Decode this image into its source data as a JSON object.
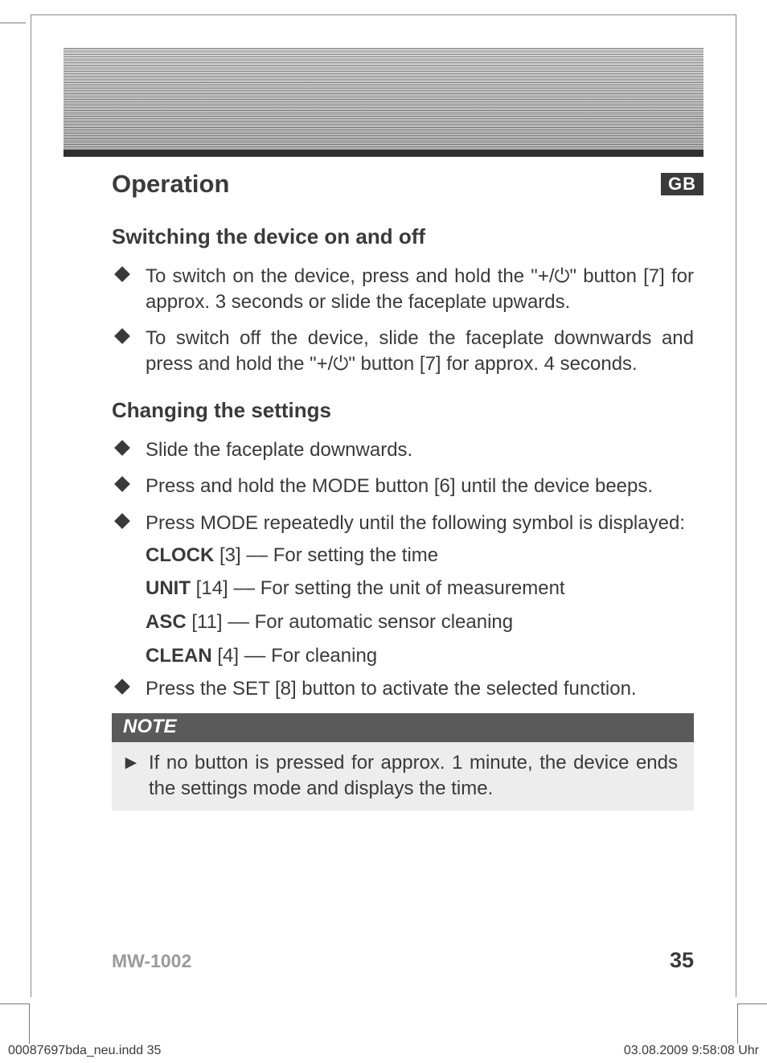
{
  "header": {
    "section": "Operation",
    "language_badge": "GB"
  },
  "sections": {
    "switching": {
      "heading": "Switching the device on and off",
      "items": [
        "To switch on the device, press and hold the \"+/⏻\" button [7] for approx. 3 seconds or slide the faceplate upwards.",
        "To switch off the device, slide the faceplate downwards and press and hold the \"+/⏻\" button [7] for approx. 4 seconds."
      ]
    },
    "changing": {
      "heading": "Changing the settings",
      "items": [
        "Slide the faceplate downwards.",
        "Press and hold the MODE button [6] until the device beeps.",
        "Press MODE repeatedly until the following symbol is displayed:"
      ],
      "modes": [
        {
          "label": "CLOCK",
          "ref": "[3]",
          "desc": "–– For setting the time"
        },
        {
          "label": "UNIT",
          "ref": "[14]",
          "desc": "–– For setting the unit of measurement"
        },
        {
          "label": "ASC",
          "ref": "[11]",
          "desc": "–– For automatic sensor cleaning"
        },
        {
          "label": "CLEAN",
          "ref": "[4]",
          "desc": "–– For cleaning"
        }
      ],
      "final_item": "Press the SET [8] button to activate the selected function."
    }
  },
  "note": {
    "title": "NOTE",
    "arrow": "►",
    "text": "If no button is pressed for approx. 1 minute, the device ends the settings mode and displays the time."
  },
  "footer": {
    "model": "MW-1002",
    "page": "35"
  },
  "slug": {
    "file": "00087697bda_neu.indd   35",
    "stamp": "03.08.2009   9:58:08 Uhr"
  }
}
